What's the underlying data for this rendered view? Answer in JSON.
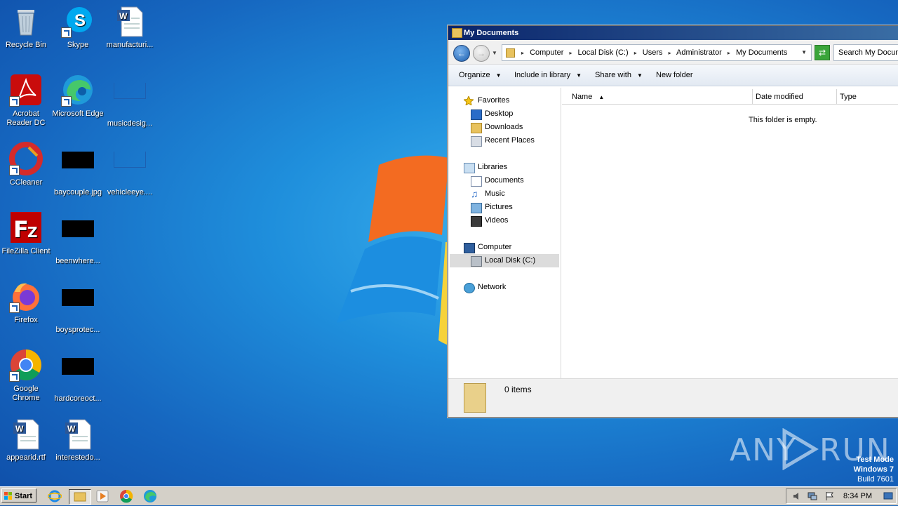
{
  "desktop": {
    "icons": [
      {
        "label": "Recycle Bin",
        "icon": "recycle-bin-icon"
      },
      {
        "label": "Skype",
        "icon": "skype-icon"
      },
      {
        "label": "manufacturi...",
        "icon": "word-doc-icon"
      },
      {
        "label": "Acrobat Reader DC",
        "icon": "acrobat-icon"
      },
      {
        "label": "Microsoft Edge",
        "icon": "edge-icon"
      },
      {
        "label": "musicdesig...",
        "icon": "file-thumb-icon"
      },
      {
        "label": "CCleaner",
        "icon": "ccleaner-icon"
      },
      {
        "label": "baycouple.jpg",
        "icon": "image-thumb-icon"
      },
      {
        "label": "vehicleeye....",
        "icon": "file-thumb-icon"
      },
      {
        "label": "FileZilla Client",
        "icon": "filezilla-icon"
      },
      {
        "label": "beenwhere...",
        "icon": "image-thumb-icon"
      },
      {
        "label": "Firefox",
        "icon": "firefox-icon"
      },
      {
        "label": "boysprotec...",
        "icon": "image-thumb-icon"
      },
      {
        "label": "Google Chrome",
        "icon": "chrome-icon"
      },
      {
        "label": "hardcoreoct...",
        "icon": "image-thumb-icon"
      },
      {
        "label": "appearid.rtf",
        "icon": "word-doc-icon"
      },
      {
        "label": "interestedo...",
        "icon": "word-doc-icon"
      }
    ],
    "watermark": {
      "line1": "Test Mode",
      "line2": "Windows 7",
      "line3": "Build 7601"
    },
    "anyrun": {
      "left": "ANY",
      "right": "RUN"
    }
  },
  "window": {
    "title": "My Documents",
    "address": {
      "crumbs": [
        "Computer",
        "Local Disk (C:)",
        "Users",
        "Administrator",
        "My Documents"
      ],
      "search_placeholder": "Search My Documents"
    },
    "toolbar": {
      "organize": "Organize",
      "include_in_library": "Include in library",
      "share_with": "Share with",
      "new_folder": "New folder"
    },
    "nav": {
      "favorites": "Favorites",
      "desktop": "Desktop",
      "downloads": "Downloads",
      "recent_places": "Recent Places",
      "libraries": "Libraries",
      "documents": "Documents",
      "music": "Music",
      "pictures": "Pictures",
      "videos": "Videos",
      "computer": "Computer",
      "local_disk": "Local Disk (C:)",
      "network": "Network"
    },
    "columns": {
      "name": "Name",
      "date_modified": "Date modified",
      "type": "Type"
    },
    "empty_message": "This folder is empty.",
    "status": "0 items"
  },
  "taskbar": {
    "start": "Start",
    "clock": "8:34 PM"
  }
}
